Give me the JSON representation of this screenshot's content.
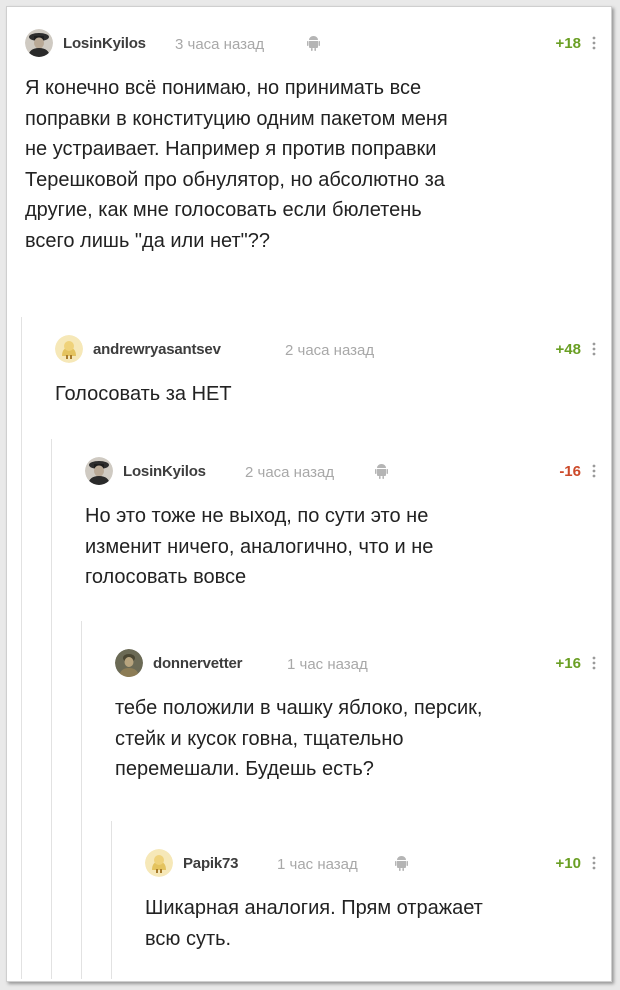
{
  "comments": [
    {
      "username": "LosinKyilos",
      "time": "3 часа назад",
      "rating": "+18",
      "text": "Я конечно всё понимаю, но принимать все\nпоправки в конституцию одним пакетом меня\nне устраивает. Например я против поправки\nТерешковой про обнулятор, но абсолютно за\nдругие, как мне голосовать если бюлетень\nвсего лишь \"да или нет\"??"
    },
    {
      "username": "andrewryasantsev",
      "time": "2 часа назад",
      "rating": "+48",
      "text": "Голосовать за НЕТ"
    },
    {
      "username": "LosinKyilos",
      "time": "2 часа назад",
      "rating": "-16",
      "text": "Но это тоже не выход, по сути это не\nизменит ничего, аналогично, что и не\nголосовать вовсе"
    },
    {
      "username": "donnervetter",
      "time": "1 час назад",
      "rating": "+16",
      "text": "тебе положили в чашку яблоко, персик,\nстейк и кусок говна, тщательно\nперемешали. Будешь есть?"
    },
    {
      "username": "Papik73",
      "time": "1 час назад",
      "rating": "+10",
      "text": "Шикарная аналогия. Прям отражает\nвсю суть."
    }
  ],
  "icons": {
    "platform": "android-icon",
    "menu": "more-vertical-icon"
  },
  "colors": {
    "positive": "#6a9f24",
    "negative": "#cc4a2a",
    "meta": "#a8a8a8"
  }
}
